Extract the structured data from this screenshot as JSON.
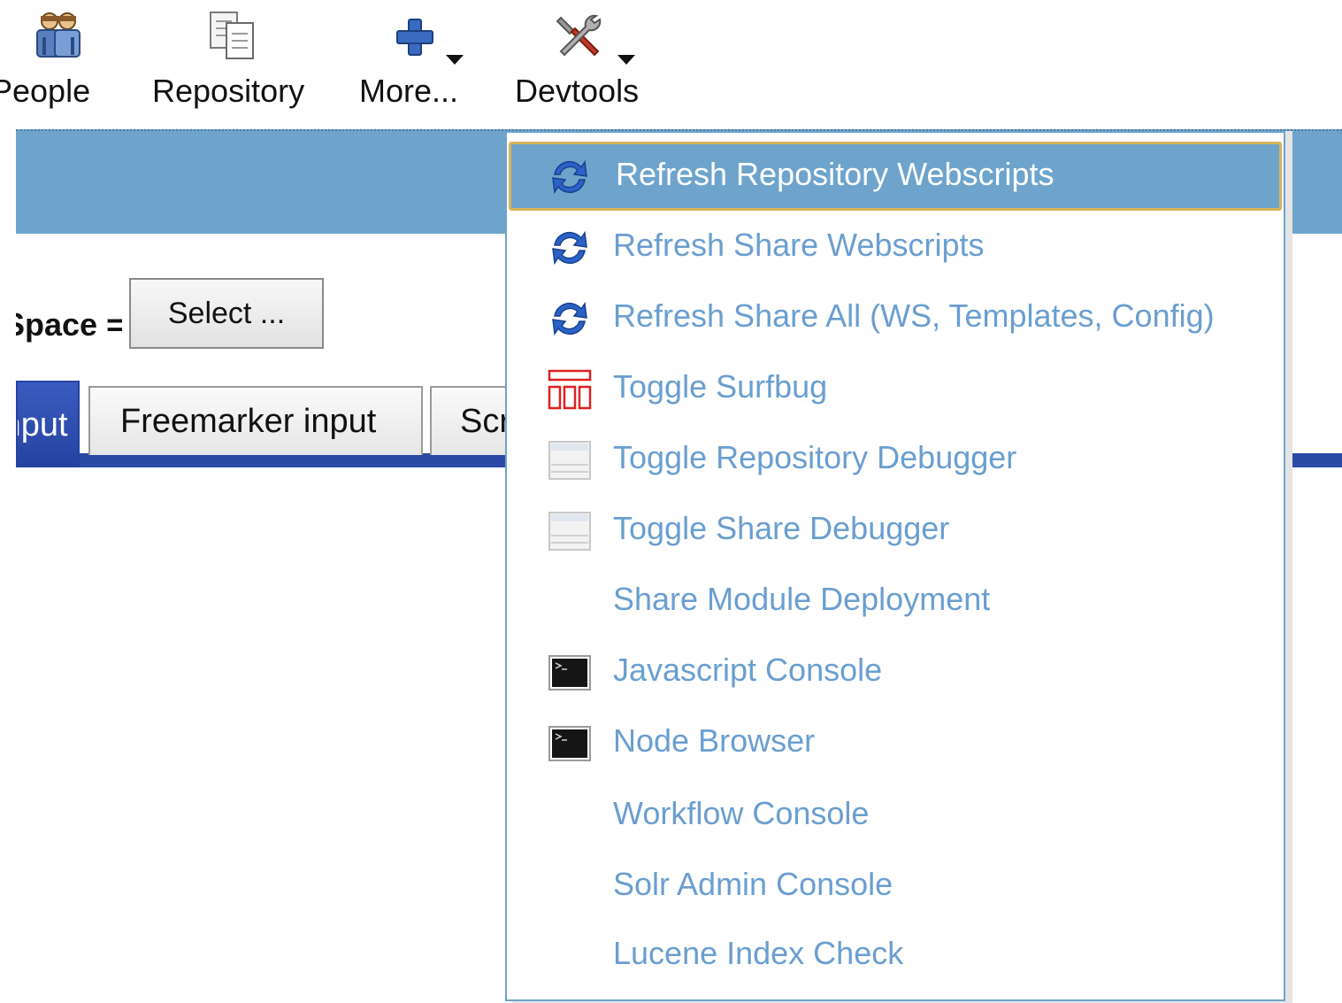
{
  "toolbar": {
    "items": [
      {
        "label": "People",
        "icon": "people-icon",
        "has_dropdown": false
      },
      {
        "label": "Repository",
        "icon": "repository-icon",
        "has_dropdown": false
      },
      {
        "label": "More...",
        "icon": "plus-icon",
        "has_dropdown": true
      },
      {
        "label": "Devtools",
        "icon": "tools-icon",
        "has_dropdown": true
      }
    ]
  },
  "namespace": {
    "label": "Space =",
    "select_label": "Select ..."
  },
  "tabs": [
    {
      "label": "Input",
      "active": true
    },
    {
      "label": "Freemarker input",
      "active": false
    },
    {
      "label": "Script",
      "active": false
    }
  ],
  "devtools_menu": {
    "items": [
      {
        "label": "Refresh Repository Webscripts",
        "icon": "refresh-icon",
        "highlighted": true
      },
      {
        "label": "Refresh Share Webscripts",
        "icon": "refresh-icon",
        "highlighted": false
      },
      {
        "label": "Refresh Share All (WS, Templates, Config)",
        "icon": "refresh-icon",
        "highlighted": false
      },
      {
        "label": "Toggle Surfbug",
        "icon": "surfbug-icon",
        "highlighted": false
      },
      {
        "label": "Toggle Repository Debugger",
        "icon": "debugger-icon",
        "highlighted": false
      },
      {
        "label": "Toggle Share Debugger",
        "icon": "debugger-icon",
        "highlighted": false
      },
      {
        "label": "Share Module Deployment",
        "icon": "",
        "highlighted": false
      },
      {
        "label": "Javascript Console",
        "icon": "console-icon",
        "highlighted": false
      },
      {
        "label": "Node Browser",
        "icon": "console-icon",
        "highlighted": false
      },
      {
        "label": "Workflow Console",
        "icon": "",
        "highlighted": false
      },
      {
        "label": "Solr Admin Console",
        "icon": "",
        "highlighted": false
      },
      {
        "label": "Lucene Index Check",
        "icon": "",
        "highlighted": false
      }
    ]
  },
  "colors": {
    "header_band": "#6ea4cc",
    "tab_active": "#2b49a5",
    "menu_text": "#6a9ed0",
    "highlight_border": "#d8b45a"
  }
}
